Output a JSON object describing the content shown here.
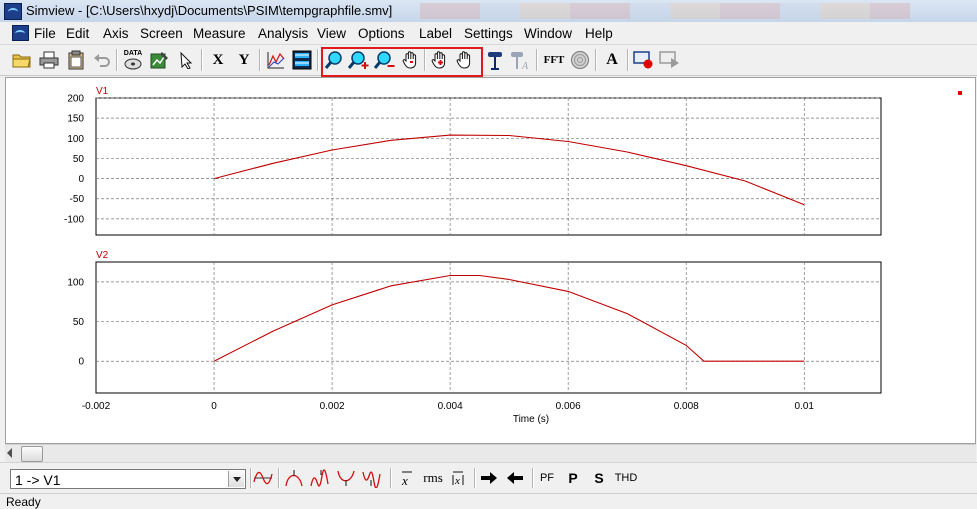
{
  "window": {
    "title": "Simview - [C:\\Users\\hxydj\\Documents\\PSIM\\tempgraphfile.smv]"
  },
  "menu": [
    "File",
    "Edit",
    "Axis",
    "Screen",
    "Measure",
    "Analysis",
    "View",
    "Options",
    "Label",
    "Settings",
    "Window",
    "Help"
  ],
  "toolbar": {
    "data_label": "DATA",
    "x_label": "X",
    "y_label": "Y",
    "fft_label": "FFT",
    "text_label": "A",
    "highlight_color": "#e01a1a",
    "icons": [
      "open-folder-icon",
      "print-icon",
      "clipboard-icon",
      "undo-icon",
      "data-disk-icon",
      "edit-graph-icon",
      "pointer-icon",
      "x-axis-icon",
      "y-axis-icon",
      "graph-icon",
      "grid-icon",
      "zoom-icon",
      "zoom-in-icon",
      "zoom-out-icon",
      "pan-hand-icon",
      "pan-hand-red-icon",
      "pan-hand-white-icon",
      "marker-icon",
      "text-marker-icon",
      "fft-icon",
      "disc-icon",
      "text-icon",
      "record-icon",
      "play-icon"
    ]
  },
  "plots": {
    "trace_color": "#c00000",
    "label_color": "#c00000",
    "v1_label": "V1",
    "v2_label": "V2",
    "x_axis_label": "Time (s)",
    "x_ticks": [
      "-0.002",
      "0",
      "0.002",
      "0.004",
      "0.006",
      "0.008",
      "0.01"
    ],
    "v1_y_ticks": [
      "200",
      "150",
      "100",
      "50",
      "0",
      "-50",
      "-100"
    ],
    "v2_y_ticks": [
      "100",
      "50",
      "0"
    ]
  },
  "chart_data": [
    {
      "type": "line",
      "title": "V1",
      "xlabel": "",
      "ylabel": "",
      "xlim": [
        -0.002,
        0.0113
      ],
      "ylim": [
        -140,
        200
      ],
      "grid": true,
      "series": [
        {
          "name": "V1",
          "x": [
            0,
            0.001,
            0.002,
            0.003,
            0.004,
            0.005,
            0.006,
            0.007,
            0.008,
            0.009,
            0.01
          ],
          "y": [
            0,
            38,
            71,
            95,
            108,
            107,
            92,
            66,
            32,
            -6,
            -65
          ]
        }
      ]
    },
    {
      "type": "line",
      "title": "V2",
      "xlabel": "Time (s)",
      "ylabel": "",
      "xlim": [
        -0.002,
        0.0113
      ],
      "ylim": [
        -40,
        125
      ],
      "grid": true,
      "series": [
        {
          "name": "V2",
          "x": [
            0,
            0.001,
            0.002,
            0.003,
            0.004,
            0.0045,
            0.005,
            0.006,
            0.007,
            0.008,
            0.0083,
            0.009,
            0.01
          ],
          "y": [
            0,
            38,
            71,
            95,
            108,
            108,
            103,
            88,
            60,
            20,
            0,
            0,
            0
          ]
        }
      ]
    }
  ],
  "bottom_toolbar": {
    "curve_select_value": "1 -> V1",
    "rms_label": "rms",
    "pf_label": "PF",
    "p_label": "P",
    "s_label": "S",
    "thd_label": "THD"
  },
  "status": {
    "text": "Ready"
  }
}
